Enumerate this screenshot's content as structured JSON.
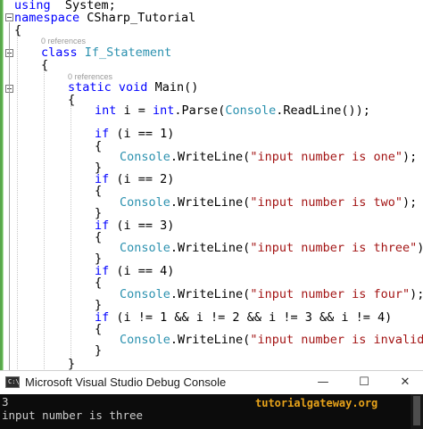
{
  "editor": {
    "lines": [
      {
        "id": "l1",
        "parts": [
          [
            "kw",
            "using"
          ],
          [
            "",
            "  System;"
          ]
        ]
      },
      {
        "id": "l2",
        "parts": [
          [
            "kw",
            "namespace"
          ],
          [
            "",
            " CSharp_Tutorial"
          ]
        ]
      },
      {
        "id": "l3",
        "parts": [
          [
            "",
            "{"
          ]
        ]
      },
      {
        "id": "l4",
        "parts": [
          [
            "kw",
            "class"
          ],
          [
            "",
            " "
          ],
          [
            "ty",
            "If_Statement"
          ]
        ]
      },
      {
        "id": "l5",
        "parts": [
          [
            "",
            "{"
          ]
        ]
      },
      {
        "id": "l6",
        "parts": [
          [
            "kw",
            "static"
          ],
          [
            "",
            " "
          ],
          [
            "kw",
            "void"
          ],
          [
            "",
            " Main()"
          ]
        ]
      },
      {
        "id": "l7",
        "parts": [
          [
            "",
            "{"
          ]
        ]
      },
      {
        "id": "l8",
        "parts": [
          [
            "kw",
            "int"
          ],
          [
            "",
            " i = "
          ],
          [
            "kw",
            "int"
          ],
          [
            "",
            ".Parse("
          ],
          [
            "ty",
            "Console"
          ],
          [
            "",
            ".ReadLine());"
          ]
        ]
      },
      {
        "id": "l9",
        "parts": [
          [
            "kw",
            "if"
          ],
          [
            "",
            " (i == 1)"
          ]
        ]
      },
      {
        "id": "l10",
        "parts": [
          [
            "",
            "{"
          ]
        ]
      },
      {
        "id": "l11",
        "parts": [
          [
            "ty",
            "Console"
          ],
          [
            "",
            ".WriteLine("
          ],
          [
            "str",
            "\"input number is one\""
          ],
          [
            "",
            ");"
          ]
        ]
      },
      {
        "id": "l12",
        "parts": [
          [
            "",
            "}"
          ]
        ]
      },
      {
        "id": "l13",
        "parts": [
          [
            "kw",
            "if"
          ],
          [
            "",
            " (i == 2)"
          ]
        ]
      },
      {
        "id": "l14",
        "parts": [
          [
            "",
            "{"
          ]
        ]
      },
      {
        "id": "l15",
        "parts": [
          [
            "ty",
            "Console"
          ],
          [
            "",
            ".WriteLine("
          ],
          [
            "str",
            "\"input number is two\""
          ],
          [
            "",
            ");"
          ]
        ]
      },
      {
        "id": "l16",
        "parts": [
          [
            "",
            "}"
          ]
        ]
      },
      {
        "id": "l17",
        "parts": [
          [
            "kw",
            "if"
          ],
          [
            "",
            " (i == 3)"
          ]
        ]
      },
      {
        "id": "l18",
        "parts": [
          [
            "",
            "{"
          ]
        ]
      },
      {
        "id": "l19",
        "parts": [
          [
            "ty",
            "Console"
          ],
          [
            "",
            ".WriteLine("
          ],
          [
            "str",
            "\"input number is three\""
          ],
          [
            "",
            ");"
          ]
        ]
      },
      {
        "id": "l20",
        "parts": [
          [
            "",
            "}"
          ]
        ]
      },
      {
        "id": "l21",
        "parts": [
          [
            "kw",
            "if"
          ],
          [
            "",
            " (i == 4)"
          ]
        ]
      },
      {
        "id": "l22",
        "parts": [
          [
            "",
            "{"
          ]
        ]
      },
      {
        "id": "l23",
        "parts": [
          [
            "ty",
            "Console"
          ],
          [
            "",
            ".WriteLine("
          ],
          [
            "str",
            "\"input number is four\""
          ],
          [
            "",
            ");"
          ]
        ]
      },
      {
        "id": "l24",
        "parts": [
          [
            "",
            "}"
          ]
        ]
      },
      {
        "id": "l25",
        "parts": [
          [
            "kw",
            "if"
          ],
          [
            "",
            " (i != 1 && i != 2 && i != 3 && i != 4)"
          ]
        ]
      },
      {
        "id": "l26",
        "parts": [
          [
            "",
            "{"
          ]
        ]
      },
      {
        "id": "l27",
        "parts": [
          [
            "ty",
            "Console"
          ],
          [
            "",
            ".WriteLine("
          ],
          [
            "str",
            "\"input number is invalid\""
          ],
          [
            "",
            ");"
          ]
        ]
      },
      {
        "id": "l28",
        "parts": [
          [
            "",
            "}"
          ]
        ]
      },
      {
        "id": "l29",
        "parts": [
          [
            "",
            "}"
          ]
        ]
      }
    ],
    "class_references": "0 references",
    "main_references": "0 references"
  },
  "console": {
    "title": "Microsoft Visual Studio Debug Console",
    "icon_text": "C:\\",
    "minimize_glyph": "—",
    "maximize_glyph": "☐",
    "close_glyph": "✕",
    "output_lines": [
      "3",
      "input number is three"
    ],
    "watermark": "tutorialgateway.org"
  },
  "colors": {
    "keyword": "#0000ff",
    "type": "#2b91af",
    "string": "#a31515",
    "gutter_green": "#57a64a",
    "console_bg": "#0c0c0c",
    "watermark": "#e8a31a"
  },
  "icons": [
    "collapse-icon",
    "console-app-icon",
    "minimize-icon",
    "maximize-icon",
    "close-icon"
  ]
}
